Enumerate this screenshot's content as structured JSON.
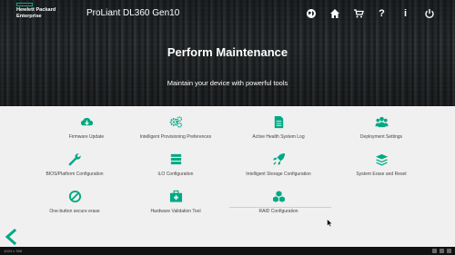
{
  "header": {
    "brand_line1": "Hewlett Packard",
    "brand_line2": "Enterprise",
    "product": "ProLiant DL360 Gen10",
    "icons": [
      "globe-icon",
      "home-icon",
      "cart-icon",
      "help-icon",
      "info-icon",
      "power-icon"
    ],
    "help_glyph": "?",
    "info_glyph": "i"
  },
  "hero": {
    "title": "Perform Maintenance",
    "subtitle": "Maintain your device with powerful tools"
  },
  "tools": [
    {
      "label": "Firmware Update",
      "icon": "cloud-download-icon"
    },
    {
      "label": "Intelligent Provisioning Preferences",
      "icon": "gears-icon"
    },
    {
      "label": "Active Health System Log",
      "icon": "document-icon"
    },
    {
      "label": "Deployment Settings",
      "icon": "users-icon"
    },
    {
      "label": "BIOS/Platform Configuration",
      "icon": "wrench-icon"
    },
    {
      "label": "iLO Configuration",
      "icon": "server-icon"
    },
    {
      "label": "Intelligent Storage Configuration",
      "icon": "rocket-icon"
    },
    {
      "label": "System Erase and Reset",
      "icon": "layers-icon"
    },
    {
      "label": "One-button secure erase",
      "icon": "ban-icon"
    },
    {
      "label": "Hardware Validation Tool",
      "icon": "medkit-icon"
    },
    {
      "label": "RAID Configuration",
      "icon": "cubes-icon"
    }
  ],
  "taskbar": {
    "text": "1024 x 768"
  },
  "colors": {
    "accent": "#01a982",
    "background": "#f0f0f0"
  }
}
